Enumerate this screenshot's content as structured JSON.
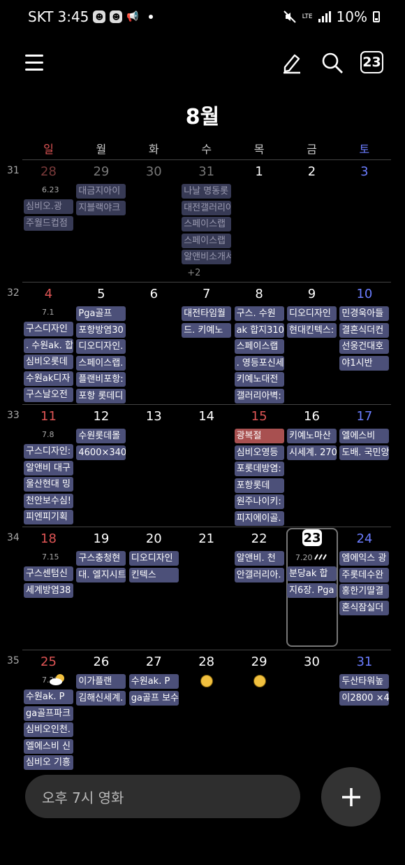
{
  "status_bar": {
    "carrier": "SKT",
    "time": "3:45",
    "network": "LTE",
    "battery": "10%"
  },
  "toolbar": {
    "today_label": "23"
  },
  "month_title": "8월",
  "weekdays": [
    {
      "label": "일",
      "color": "#e05555"
    },
    {
      "label": "월",
      "color": "#cccccc"
    },
    {
      "label": "화",
      "color": "#cccccc"
    },
    {
      "label": "수",
      "color": "#cccccc"
    },
    {
      "label": "목",
      "color": "#cccccc"
    },
    {
      "label": "금",
      "color": "#cccccc"
    },
    {
      "label": "토",
      "color": "#6b7dff"
    }
  ],
  "weeks": [
    {
      "num": "31",
      "days": [
        {
          "d": "28",
          "type": "sun",
          "other": true,
          "lunar": "6.23",
          "events": [
            "심비오.광",
            "주월드컵점"
          ]
        },
        {
          "d": "29",
          "other": true,
          "events": [
            "대금지아이",
            "지블랙야크"
          ]
        },
        {
          "d": "30",
          "other": true,
          "events": []
        },
        {
          "d": "31",
          "other": true,
          "events": [
            "나날 명동롯",
            "대전갤러리아",
            "스페이스랩",
            "스페이스랩",
            "알앤비소개서"
          ],
          "more": "+2"
        },
        {
          "d": "1",
          "events": []
        },
        {
          "d": "2",
          "events": []
        },
        {
          "d": "3",
          "type": "sat",
          "events": []
        }
      ]
    },
    {
      "num": "32",
      "days": [
        {
          "d": "4",
          "type": "sun",
          "lunar": "7.1",
          "events": [
            "구스디자인",
            ". 수원ak. 합",
            "심비오롯데",
            "수원ak디자",
            "구스날오전"
          ]
        },
        {
          "d": "5",
          "events": [
            "Pga골프",
            "포항방염30",
            "디오디자인.",
            "스페이스랩.",
            "플랜비포항:",
            "포항 롯데디"
          ]
        },
        {
          "d": "6",
          "events": []
        },
        {
          "d": "7",
          "events": [
            "대전타임월",
            "드. 키예노"
          ]
        },
        {
          "d": "8",
          "events": [
            "구스. 수원",
            "ak 합지310",
            "스페이스랩",
            ". 영등포신세",
            "키예노대전",
            "갤러리아벽:"
          ]
        },
        {
          "d": "9",
          "events": [
            "디오디자인",
            "현대킨텍스:"
          ]
        },
        {
          "d": "10",
          "type": "sat",
          "events": [
            "민경욱아들",
            "결혼식더컨",
            "선웅건대호",
            "야1시반"
          ]
        }
      ]
    },
    {
      "num": "33",
      "days": [
        {
          "d": "11",
          "type": "sun",
          "lunar": "7.8",
          "events": [
            "구스디자인:",
            "알앤비 대구",
            "울산현대 밍",
            "천안보수심!",
            "피엔피기획"
          ]
        },
        {
          "d": "12",
          "events": [
            "수원롯데몰",
            "4600×340"
          ]
        },
        {
          "d": "13",
          "events": []
        },
        {
          "d": "14",
          "events": []
        },
        {
          "d": "15",
          "type": "sun",
          "holiday": "광복절",
          "events": [
            "심비오영등",
            "포롯데방염:",
            "포항롯데",
            "원주나이키:",
            "피지에이골."
          ]
        },
        {
          "d": "16",
          "events": [
            "키예노마산",
            "시세계. 270"
          ]
        },
        {
          "d": "17",
          "type": "sat",
          "events": [
            "엘에스비",
            "도배. 국민앙"
          ]
        }
      ]
    },
    {
      "num": "34",
      "days": [
        {
          "d": "18",
          "type": "sun",
          "lunar": "7.15",
          "events": [
            "구스센텀신",
            "세계방염38"
          ]
        },
        {
          "d": "19",
          "events": [
            "구스충청현",
            "대. 엘지시트"
          ]
        },
        {
          "d": "20",
          "events": [
            "디오디자인",
            "킨텍스"
          ]
        },
        {
          "d": "21",
          "events": []
        },
        {
          "d": "22",
          "events": [
            "알앤비. 천",
            "안갤러리아."
          ]
        },
        {
          "d": "23",
          "today": true,
          "lunar": "7.20",
          "weather": "rain",
          "events": [
            "분당ak 합",
            "지6장. Pga"
          ]
        },
        {
          "d": "24",
          "type": "sat",
          "weather": "sun",
          "events": [
            "엠에익스 광",
            "주롯데수완",
            "홍한기딸결",
            "혼식잠실더"
          ]
        }
      ]
    },
    {
      "num": "35",
      "days": [
        {
          "d": "25",
          "type": "sun",
          "lunar": "7.22",
          "weather": "cloud",
          "events": [
            "수원ak. P",
            "ga골프파크",
            "심비오인천.",
            "엘에스비 신",
            "심비오 기흥"
          ]
        },
        {
          "d": "26",
          "weather": "sun",
          "events": [
            "이가플랜",
            "김해신세계."
          ]
        },
        {
          "d": "27",
          "weather": "sun",
          "events": [
            "수원ak. P",
            "ga골프 보수"
          ]
        },
        {
          "d": "28",
          "weather": "sun",
          "events": []
        },
        {
          "d": "29",
          "weather": "sun",
          "events": []
        },
        {
          "d": "30",
          "events": []
        },
        {
          "d": "31",
          "type": "sat",
          "events": [
            "두산타워높",
            "이2800 ×4"
          ]
        }
      ]
    }
  ],
  "quick_input": {
    "placeholder": "오후 7시 영화"
  }
}
